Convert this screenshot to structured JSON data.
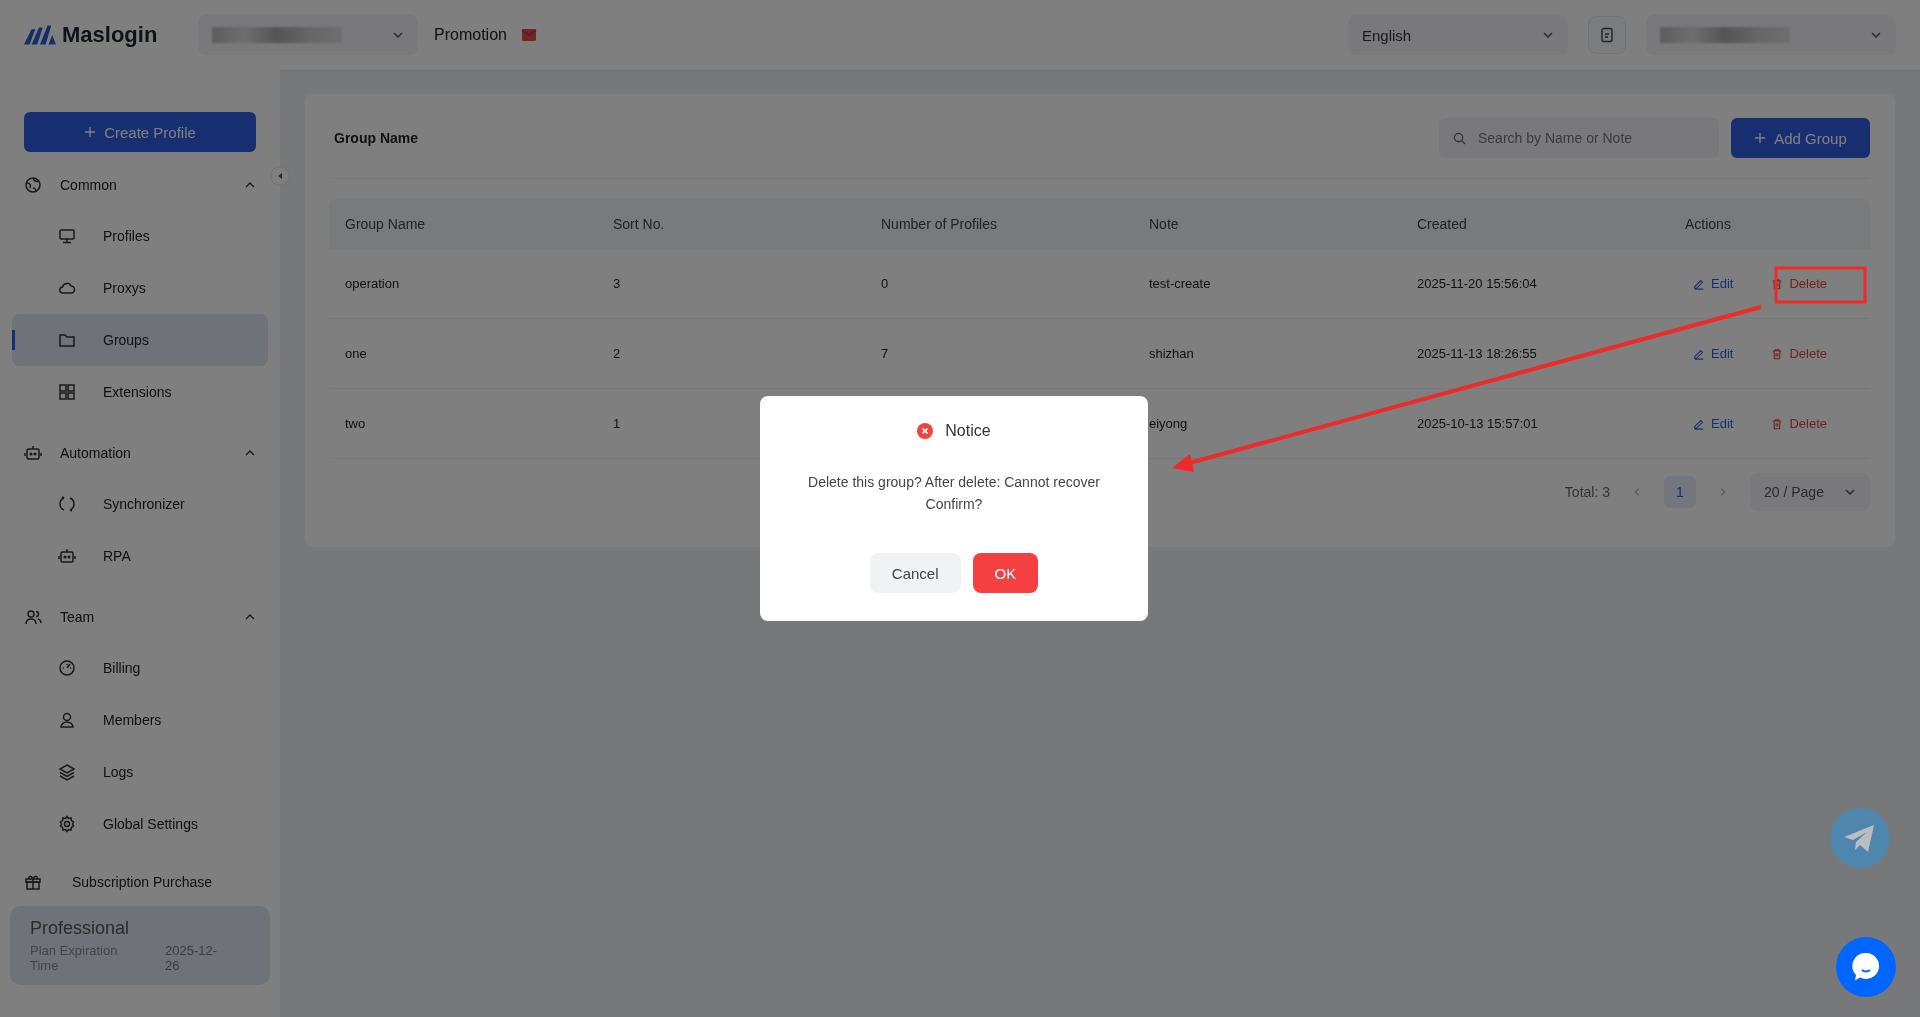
{
  "header": {
    "logo": "Maslogin",
    "promotion": "Promotion",
    "language": "English"
  },
  "sidebar": {
    "create_button": "Create Profile",
    "sections": [
      {
        "title": "Common",
        "expanded": true,
        "items": [
          {
            "label": "Profiles",
            "selected": false
          },
          {
            "label": "Proxys",
            "selected": false
          },
          {
            "label": "Groups",
            "selected": true
          },
          {
            "label": "Extensions",
            "selected": false
          }
        ]
      },
      {
        "title": "Automation",
        "expanded": true,
        "items": [
          {
            "label": "Synchronizer",
            "selected": false
          },
          {
            "label": "RPA",
            "selected": false
          }
        ]
      },
      {
        "title": "Team",
        "expanded": true,
        "items": [
          {
            "label": "Billing",
            "selected": false
          },
          {
            "label": "Members",
            "selected": false
          },
          {
            "label": "Logs",
            "selected": false
          },
          {
            "label": "Global Settings",
            "selected": false
          }
        ]
      }
    ],
    "subscription": "Subscription Purchase",
    "plan": {
      "name": "Professional",
      "expiry_label": "Plan Expiration Time",
      "expiry_date": "2025-12-26"
    }
  },
  "content": {
    "title": "Group Name",
    "search": {
      "placeholder": "Search by Name or Note"
    },
    "add_button": "Add Group",
    "table": {
      "columns": [
        "Group Name",
        "Sort No.",
        "Number of Profiles",
        "Note",
        "Created",
        "Actions"
      ],
      "rows": [
        {
          "group_name": "operation",
          "sort_no": "3",
          "profiles": "0",
          "note": "test-create",
          "created": "2025-11-20 15:56:04",
          "actions": [
            "Edit",
            "Delete"
          ]
        },
        {
          "group_name": "one",
          "sort_no": "2",
          "profiles": "7",
          "note": "shizhan",
          "created": "2025-11-13 18:26:55",
          "actions": [
            "Edit",
            "Delete"
          ]
        },
        {
          "group_name": "two",
          "sort_no": "1",
          "note": "eiyong",
          "created": "2025-10-13 15:57:01",
          "actions": [
            "Edit",
            "Delete"
          ]
        }
      ]
    },
    "pagination": {
      "total": "Total: 3",
      "pages": [
        {
          "label": "1",
          "selected": true
        }
      ],
      "page_size": "20 / Page"
    }
  },
  "dialog": {
    "title": "Notice",
    "message": "Delete this group? After delete: Cannot recover",
    "question": "Confirm?",
    "buttons": [
      {
        "label": "Cancel",
        "kind": "secondary"
      },
      {
        "label": "OK",
        "kind": "danger"
      }
    ]
  }
}
